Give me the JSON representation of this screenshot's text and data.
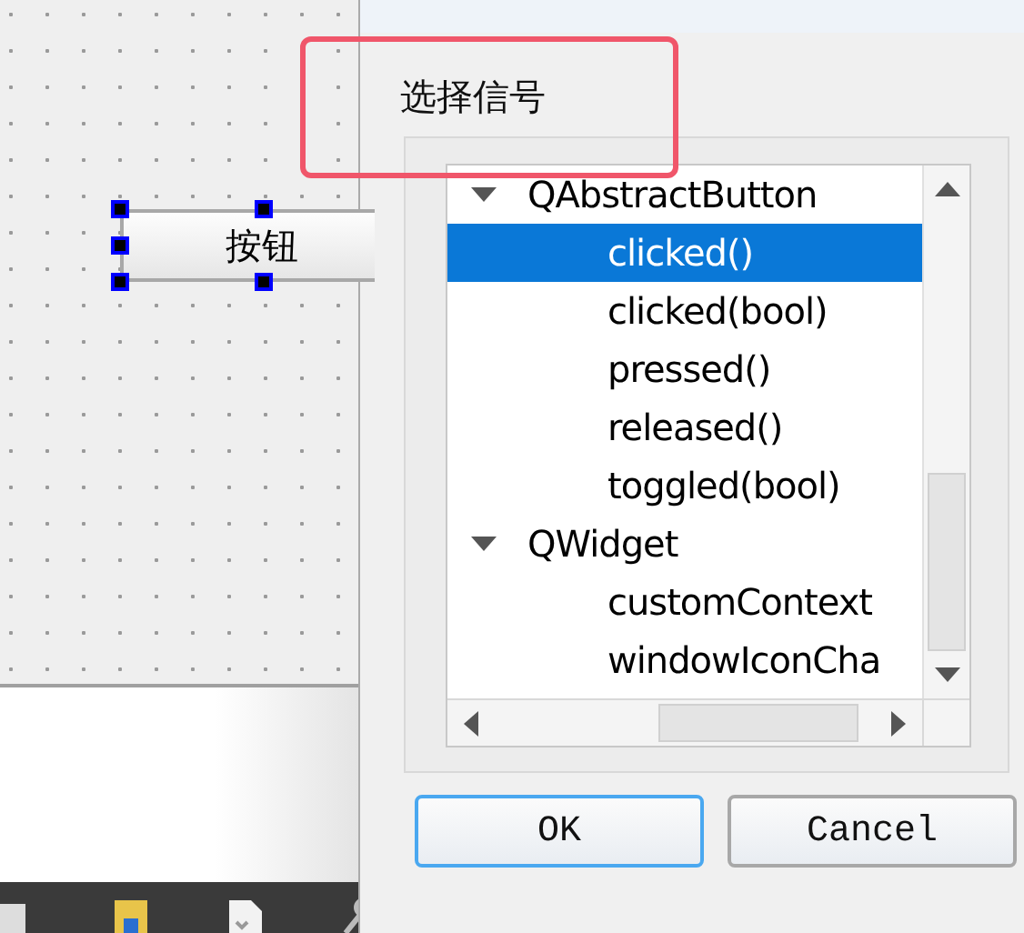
{
  "designer": {
    "widget": {
      "label": "按钮",
      "selected": true
    }
  },
  "dialog": {
    "heading": "选择信号",
    "tree": [
      {
        "label": "QAbstractButton",
        "expanded": true,
        "children": [
          {
            "label": "clicked()",
            "selected": true
          },
          {
            "label": "clicked(bool)",
            "selected": false
          },
          {
            "label": "pressed()",
            "selected": false
          },
          {
            "label": "released()",
            "selected": false
          },
          {
            "label": "toggled(bool)",
            "selected": false
          }
        ]
      },
      {
        "label": "QWidget",
        "expanded": true,
        "children": [
          {
            "label": "customContext",
            "selected": false
          },
          {
            "label": "windowIconCha",
            "selected": false
          }
        ]
      }
    ],
    "buttons": [
      {
        "label": "OK",
        "default": true
      },
      {
        "label": "Cancel",
        "default": false
      }
    ]
  }
}
